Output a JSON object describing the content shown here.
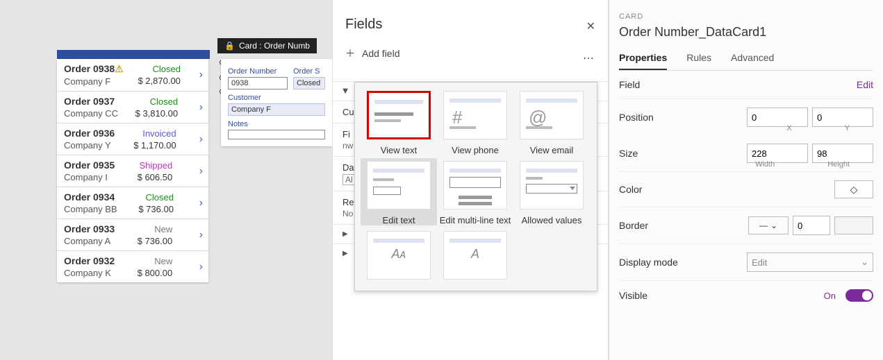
{
  "selection_tag": {
    "icon": "lock-icon",
    "label": "Card : Order Numb"
  },
  "orders": [
    {
      "title": "Order 0938",
      "company": "Company F",
      "status": "Closed",
      "price": "$ 2,870.00",
      "warn": true
    },
    {
      "title": "Order 0937",
      "company": "Company CC",
      "status": "Closed",
      "price": "$ 3,810.00",
      "warn": false
    },
    {
      "title": "Order 0936",
      "company": "Company Y",
      "status": "Invoiced",
      "price": "$ 1,170.00",
      "warn": false
    },
    {
      "title": "Order 0935",
      "company": "Company I",
      "status": "Shipped",
      "price": "$ 606.50",
      "warn": false
    },
    {
      "title": "Order 0934",
      "company": "Company BB",
      "status": "Closed",
      "price": "$ 736.00",
      "warn": false
    },
    {
      "title": "Order 0933",
      "company": "Company A",
      "status": "New",
      "price": "$ 736.00",
      "warn": false
    },
    {
      "title": "Order 0932",
      "company": "Company K",
      "status": "New",
      "price": "$ 800.00",
      "warn": false
    }
  ],
  "form": {
    "order_number_label": "Order Number",
    "order_number_value": "0938",
    "order_status_label": "Order S",
    "order_status_value": "Closed",
    "customer_label": "Customer",
    "customer_value": "Company F",
    "notes_label": "Notes"
  },
  "fields_panel": {
    "title": "Fields",
    "add_field": "Add field",
    "sections": {
      "c_truncated": "Cu",
      "fi_truncated": "Fi",
      "nw_truncated": "nw",
      "da_truncated": "Da",
      "al_truncated": "Al",
      "re_truncated": "Re",
      "no_truncated": "No"
    }
  },
  "picker": {
    "view_text": "View text",
    "view_phone": "View phone",
    "view_email": "View email",
    "edit_text": "Edit text",
    "edit_multiline": "Edit multi-line text",
    "allowed_values": "Allowed values",
    "hash": "#",
    "at": "@",
    "aa": "Aᴀ"
  },
  "props": {
    "category": "CARD",
    "name": "Order Number_DataCard1",
    "tabs": {
      "properties": "Properties",
      "rules": "Rules",
      "advanced": "Advanced"
    },
    "field_label": "Field",
    "edit_link": "Edit",
    "position_label": "Position",
    "x": "0",
    "y": "0",
    "x_label": "X",
    "y_label": "Y",
    "size_label": "Size",
    "width": "228",
    "height": "98",
    "w_label": "Width",
    "h_label": "Height",
    "color_label": "Color",
    "border_label": "Border",
    "border_value": "0",
    "display_mode_label": "Display mode",
    "display_mode_value": "Edit",
    "visible_label": "Visible",
    "visible_on": "On"
  }
}
